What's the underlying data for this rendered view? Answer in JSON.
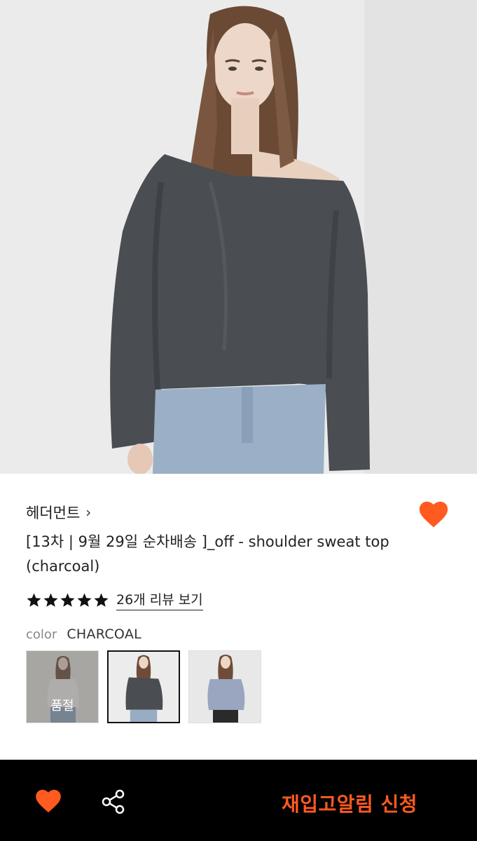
{
  "product": {
    "brand": "헤더먼트",
    "brand_chevron": "›",
    "title": "[13차 | 9월 29일 순차배송 ]_off - shoulder sweat top (charcoal)",
    "rating": 5,
    "review_link": "26개 리뷰 보기",
    "wishlisted": true
  },
  "options": {
    "color_label": "color",
    "color_value": "CHARCOAL",
    "swatches": [
      {
        "name": "swatch-1",
        "soldout_label": "품절",
        "selected": false
      },
      {
        "name": "swatch-2",
        "selected": true
      },
      {
        "name": "swatch-3",
        "selected": false
      }
    ]
  },
  "bottom_bar": {
    "heart_icon": "heart-icon",
    "share_icon": "share-icon",
    "restock_label": "재입고알림 신청"
  },
  "colors": {
    "accent": "#ff5a1f",
    "bottom_bar_bg": "#000000"
  }
}
